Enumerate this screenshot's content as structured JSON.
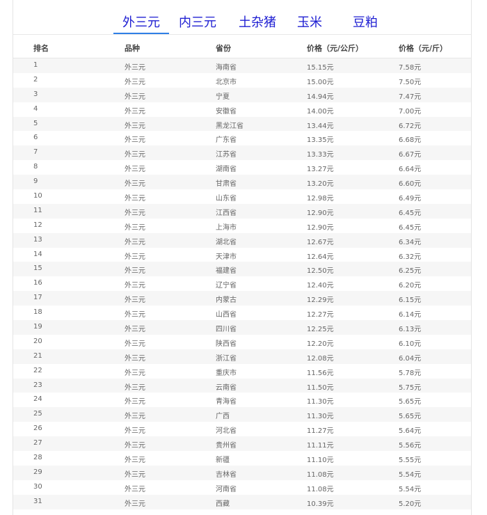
{
  "tabs": [
    {
      "label": "外三元",
      "active": true
    },
    {
      "label": "内三元",
      "active": false
    },
    {
      "label": "土杂猪",
      "active": false
    },
    {
      "label": "玉米",
      "active": false
    },
    {
      "label": "豆粕",
      "active": false
    }
  ],
  "accent_color": "#2f7fe6",
  "tab_text_color": "#1e1ed2",
  "table": {
    "headers": [
      "排名",
      "品种",
      "省份",
      "价格（元/公斤）",
      "价格（元/斤）"
    ],
    "rows": [
      [
        "1",
        "外三元",
        "海南省",
        "15.15元",
        "7.58元"
      ],
      [
        "2",
        "外三元",
        "北京市",
        "15.00元",
        "7.50元"
      ],
      [
        "3",
        "外三元",
        "宁夏",
        "14.94元",
        "7.47元"
      ],
      [
        "4",
        "外三元",
        "安徽省",
        "14.00元",
        "7.00元"
      ],
      [
        "5",
        "外三元",
        "黑龙江省",
        "13.44元",
        "6.72元"
      ],
      [
        "6",
        "外三元",
        "广东省",
        "13.35元",
        "6.68元"
      ],
      [
        "7",
        "外三元",
        "江苏省",
        "13.33元",
        "6.67元"
      ],
      [
        "8",
        "外三元",
        "湖南省",
        "13.27元",
        "6.64元"
      ],
      [
        "9",
        "外三元",
        "甘肃省",
        "13.20元",
        "6.60元"
      ],
      [
        "10",
        "外三元",
        "山东省",
        "12.98元",
        "6.49元"
      ],
      [
        "11",
        "外三元",
        "江西省",
        "12.90元",
        "6.45元"
      ],
      [
        "12",
        "外三元",
        "上海市",
        "12.90元",
        "6.45元"
      ],
      [
        "13",
        "外三元",
        "湖北省",
        "12.67元",
        "6.34元"
      ],
      [
        "14",
        "外三元",
        "天津市",
        "12.64元",
        "6.32元"
      ],
      [
        "15",
        "外三元",
        "福建省",
        "12.50元",
        "6.25元"
      ],
      [
        "16",
        "外三元",
        "辽宁省",
        "12.40元",
        "6.20元"
      ],
      [
        "17",
        "外三元",
        "内蒙古",
        "12.29元",
        "6.15元"
      ],
      [
        "18",
        "外三元",
        "山西省",
        "12.27元",
        "6.14元"
      ],
      [
        "19",
        "外三元",
        "四川省",
        "12.25元",
        "6.13元"
      ],
      [
        "20",
        "外三元",
        "陕西省",
        "12.20元",
        "6.10元"
      ],
      [
        "21",
        "外三元",
        "浙江省",
        "12.08元",
        "6.04元"
      ],
      [
        "22",
        "外三元",
        "重庆市",
        "11.56元",
        "5.78元"
      ],
      [
        "23",
        "外三元",
        "云南省",
        "11.50元",
        "5.75元"
      ],
      [
        "24",
        "外三元",
        "青海省",
        "11.30元",
        "5.65元"
      ],
      [
        "25",
        "外三元",
        "广西",
        "11.30元",
        "5.65元"
      ],
      [
        "26",
        "外三元",
        "河北省",
        "11.27元",
        "5.64元"
      ],
      [
        "27",
        "外三元",
        "贵州省",
        "11.11元",
        "5.56元"
      ],
      [
        "28",
        "外三元",
        "新疆",
        "11.10元",
        "5.55元"
      ],
      [
        "29",
        "外三元",
        "吉林省",
        "11.08元",
        "5.54元"
      ],
      [
        "30",
        "外三元",
        "河南省",
        "11.08元",
        "5.54元"
      ],
      [
        "31",
        "外三元",
        "西藏",
        "10.39元",
        "5.20元"
      ]
    ]
  }
}
